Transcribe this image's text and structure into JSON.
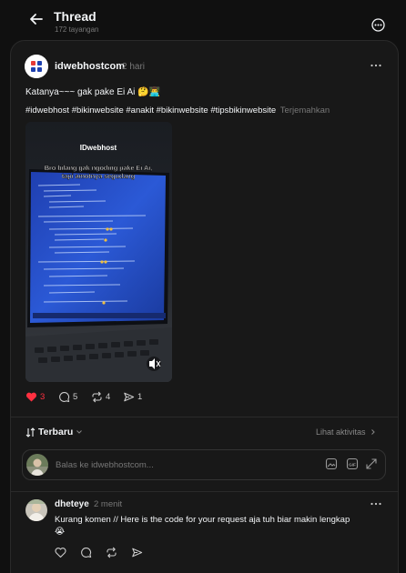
{
  "header": {
    "title": "Thread",
    "views": "172 tayangan"
  },
  "post": {
    "author": "idwebhostcom",
    "time": "2 hari",
    "text": "Katanya~~~ gak pake Ei Ai 🤔👨‍💻",
    "tags": "#idwebhost #bikinwebsite #anakit #bikinwebsite #tipsbikinwebsite",
    "translate_label": "Terjemahkan",
    "media": {
      "brand": "IDwebhost",
      "caption_line1": "Bro bilang gak ngoding pake Ei Ai,",
      "caption_line2": "tapi amotnya segudang"
    },
    "stats": {
      "likes": "3",
      "replies": "5",
      "reposts": "4",
      "shares": "1"
    }
  },
  "replies_bar": {
    "sort_label": "Terbaru",
    "activity_label": "Lihat aktivitas"
  },
  "reply_box": {
    "placeholder": "Balas ke idwebhostcom..."
  },
  "comment": {
    "author": "dheteye",
    "time": "2 menit",
    "text": "Kurang komen // Here is the code for your request aja tuh biar makin lengkap 😭"
  },
  "colors": {
    "background": "#101010",
    "card": "#181818",
    "like": "#ff3040",
    "muted": "#777777"
  },
  "icons": [
    "back-arrow-icon",
    "more-circle-icon",
    "more-dots-icon",
    "heart-icon",
    "comment-icon",
    "repost-icon",
    "share-icon",
    "sort-icon",
    "chevron-down-icon",
    "chevron-right-icon",
    "image-icon",
    "gif-icon",
    "expand-icon",
    "mute-icon"
  ]
}
